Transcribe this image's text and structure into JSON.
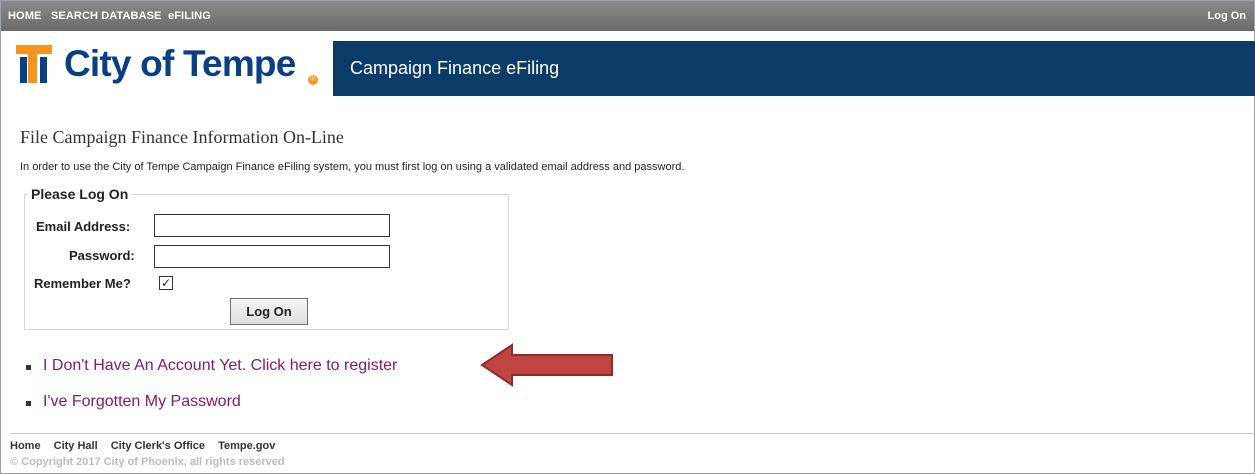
{
  "topnav": {
    "items": [
      "HOME",
      "SEARCH DATABASE",
      "eFILING"
    ],
    "logon": "Log On"
  },
  "header": {
    "logo_text": "City of Tempe",
    "logo_mark": "®",
    "banner_title": "Campaign Finance eFiling",
    "brand_color": "#0b3c68",
    "logo_accent": "#f7941d"
  },
  "main": {
    "title": "File Campaign Finance Information On-Line",
    "intro": "In order to use the City of Tempe Campaign Finance eFiling system, you must first log on using a validated email address and password.",
    "login": {
      "legend": "Please Log On",
      "email_label": "Email Address:",
      "email_value": "",
      "password_label": "Password:",
      "password_value": "",
      "remember_label": "Remember Me?",
      "remember_checked": "✓",
      "submit_label": "Log On"
    },
    "links": [
      "I Don't Have An Account Yet. Click here to register",
      "I've Forgotten My Password"
    ],
    "annotation": {
      "icon": "red-arrow-icon",
      "color": "#c0443f"
    }
  },
  "footer": {
    "links": [
      "Home",
      "City Hall",
      "City Clerk's Office",
      "Tempe.gov"
    ],
    "copyright": "© Copyright 2017 City of Phoenix, all rights reserved"
  }
}
